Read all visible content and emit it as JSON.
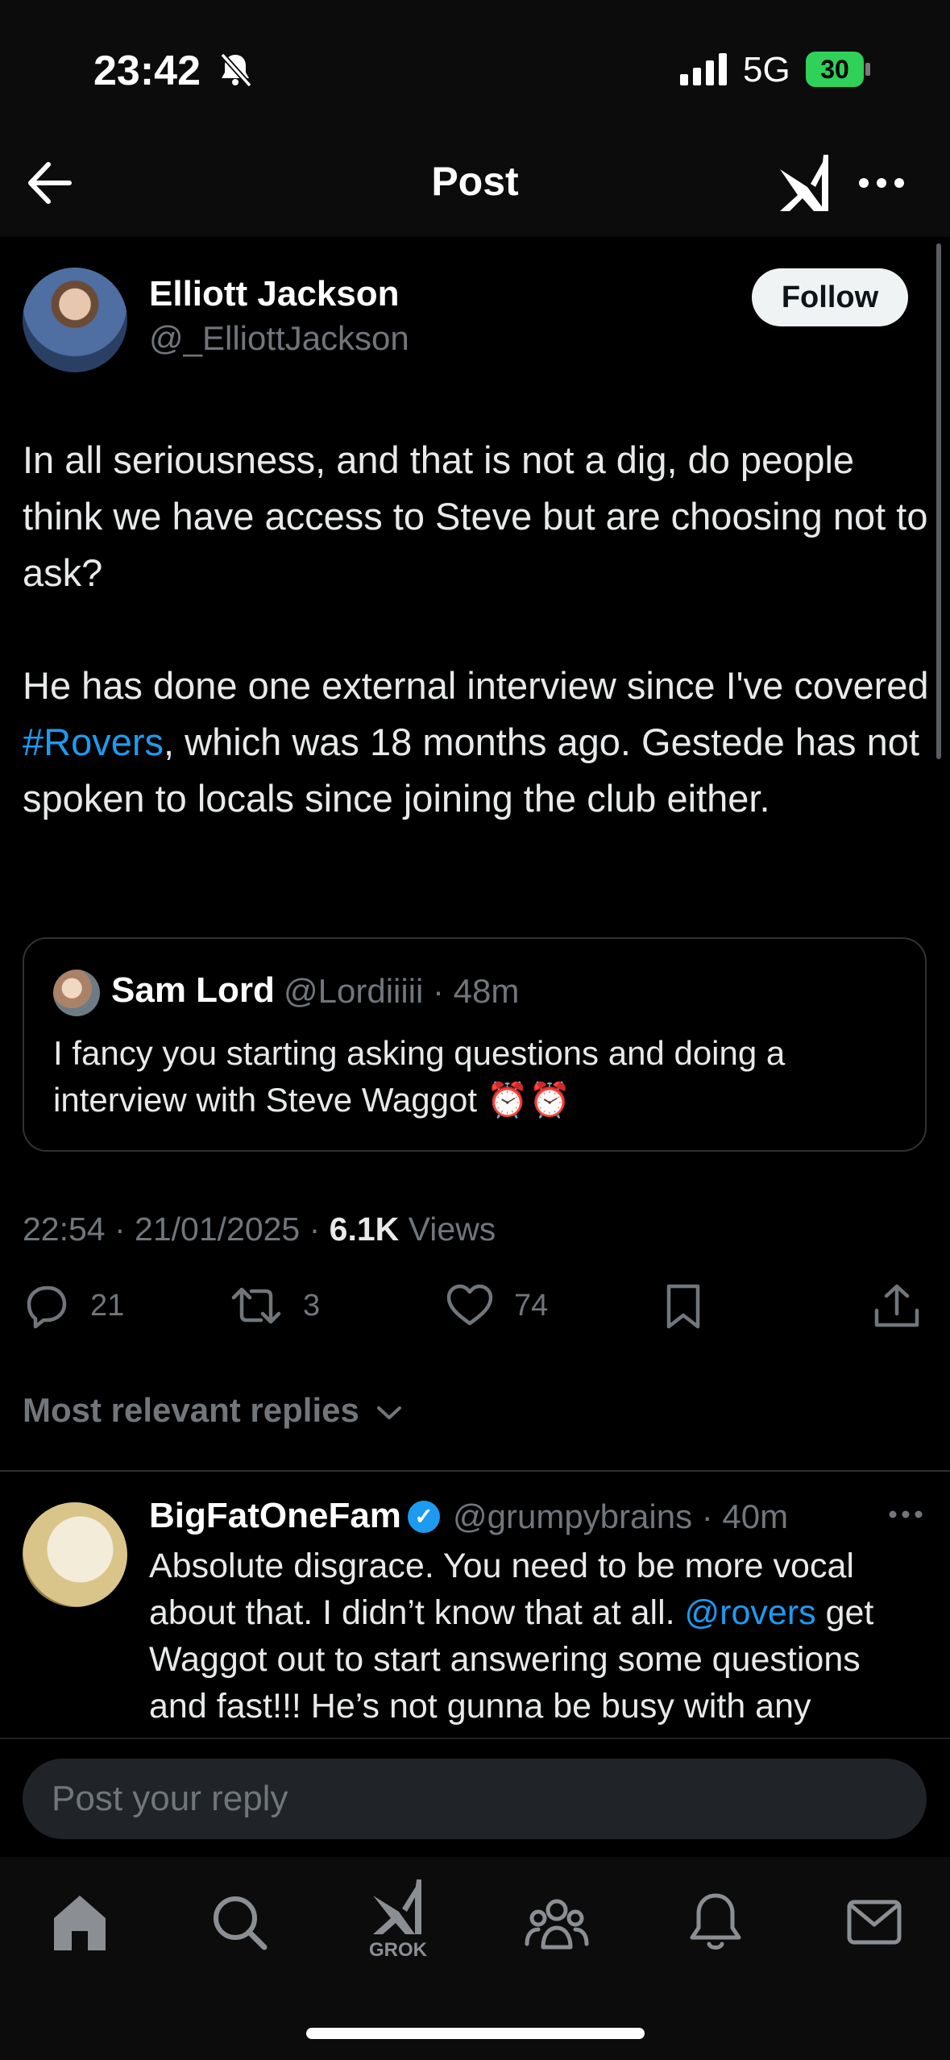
{
  "status_bar": {
    "time": "23:42",
    "network": "5G",
    "battery": "30"
  },
  "header": {
    "title": "Post"
  },
  "post": {
    "author_name": "Elliott Jackson",
    "author_handle": "@_ElliottJackson",
    "follow_label": "Follow",
    "text_part1": "In all seriousness, and that is not a dig, do people think we have access to Steve but are choosing not to ask?\n\nHe has done one external interview since I've covered ",
    "hashtag": "#Rovers",
    "text_part2": ", which was 18 months ago. Gestede has not spoken to locals since joining the club either.",
    "timestamp": "22:54 · 21/01/2025 · ",
    "views_count": "6.1K",
    "views_label": " Views",
    "replies": "21",
    "reposts": "3",
    "likes": "74"
  },
  "quote": {
    "author_name": "Sam Lord",
    "meta": "@Lordiiiii · 48m",
    "text": "I fancy you starting asking questions and doing a interview with Steve Waggot ⏰⏰"
  },
  "replies_filter": {
    "label": "Most relevant replies"
  },
  "reply": {
    "author_name": "BigFatOneFam",
    "meta": "@grumpybrains · 40m",
    "text_part1": "Absolute disgrace. You need to be more vocal about that. I didn’t know that at all. ",
    "mention": "@rovers",
    "text_part2": " get Waggot out to start answering some questions and fast!!! He’s not gunna be busy with any transfers or scouting or anything"
  },
  "composer": {
    "placeholder": "Post your reply"
  },
  "tabbar": {
    "grok_label": "GROK"
  },
  "colors": {
    "accent": "#1d9bf0",
    "background": "#000000",
    "muted": "#71767b"
  }
}
